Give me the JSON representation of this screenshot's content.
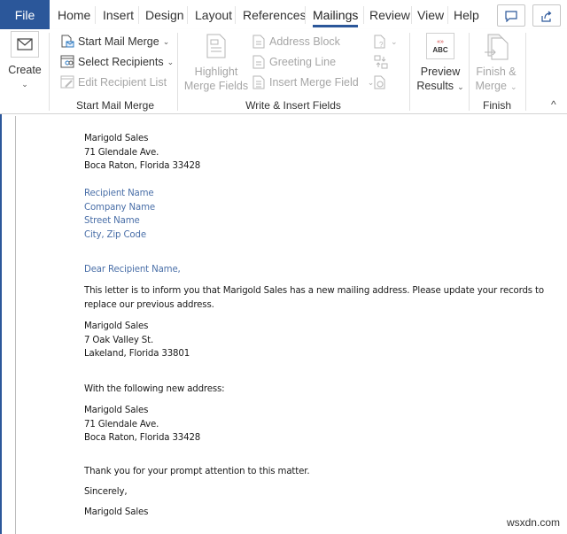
{
  "tabs": {
    "file": "File",
    "items": [
      {
        "label": "Home",
        "active": false
      },
      {
        "label": "Insert",
        "active": false
      },
      {
        "label": "Design",
        "active": false
      },
      {
        "label": "Layout",
        "active": false
      },
      {
        "label": "References",
        "active": false
      },
      {
        "label": "Mailings",
        "active": true
      },
      {
        "label": "Review",
        "active": false
      },
      {
        "label": "View",
        "active": false
      },
      {
        "label": "Help",
        "active": false
      }
    ],
    "comments_icon": "comment-icon",
    "share_icon": "share-icon"
  },
  "ribbon": {
    "create": {
      "label": "Create",
      "icon": "envelope-icon"
    },
    "start_mail_merge": {
      "group_label": "Start Mail Merge",
      "start_mail_merge": "Start Mail Merge",
      "select_recipients": "Select Recipients",
      "edit_recipient_list": "Edit Recipient List"
    },
    "write_insert": {
      "group_label": "Write & Insert Fields",
      "highlight_line1": "Highlight",
      "highlight_line2": "Merge Fields",
      "address_block": "Address Block",
      "greeting_line": "Greeting Line",
      "insert_merge_field": "Insert Merge Field"
    },
    "preview": {
      "abc": "ABC",
      "line1": "Preview",
      "line2": "Results"
    },
    "finish": {
      "group_label": "Finish",
      "line1": "Finish &",
      "line2": "Merge"
    }
  },
  "document": {
    "sender": [
      "Marigold Sales",
      "71 Glendale Ave.",
      "Boca Raton, Florida 33428"
    ],
    "recipient_fields": [
      "Recipient Name",
      "Company Name",
      "Street Name",
      "City, Zip Code"
    ],
    "greeting": "Dear Recipient Name,",
    "body_line1": "This letter is to inform you that Marigold Sales has a new mailing address. Please update your records to",
    "body_line2": "replace our previous address.",
    "old_address": [
      "Marigold Sales",
      "7 Oak Valley St.",
      "Lakeland, Florida 33801"
    ],
    "new_address_intro": "With the following new address:",
    "new_address": [
      "Marigold Sales",
      "71 Glendale Ave.",
      "Boca Raton, Florida 33428"
    ],
    "thanks": "Thank you for your prompt attention to this matter.",
    "closing": "Sincerely,",
    "signature": "Marigold Sales"
  },
  "watermark": "wsxdn.com",
  "colors": {
    "accent": "#2b579a",
    "merge_field": "#4a6fa8"
  }
}
